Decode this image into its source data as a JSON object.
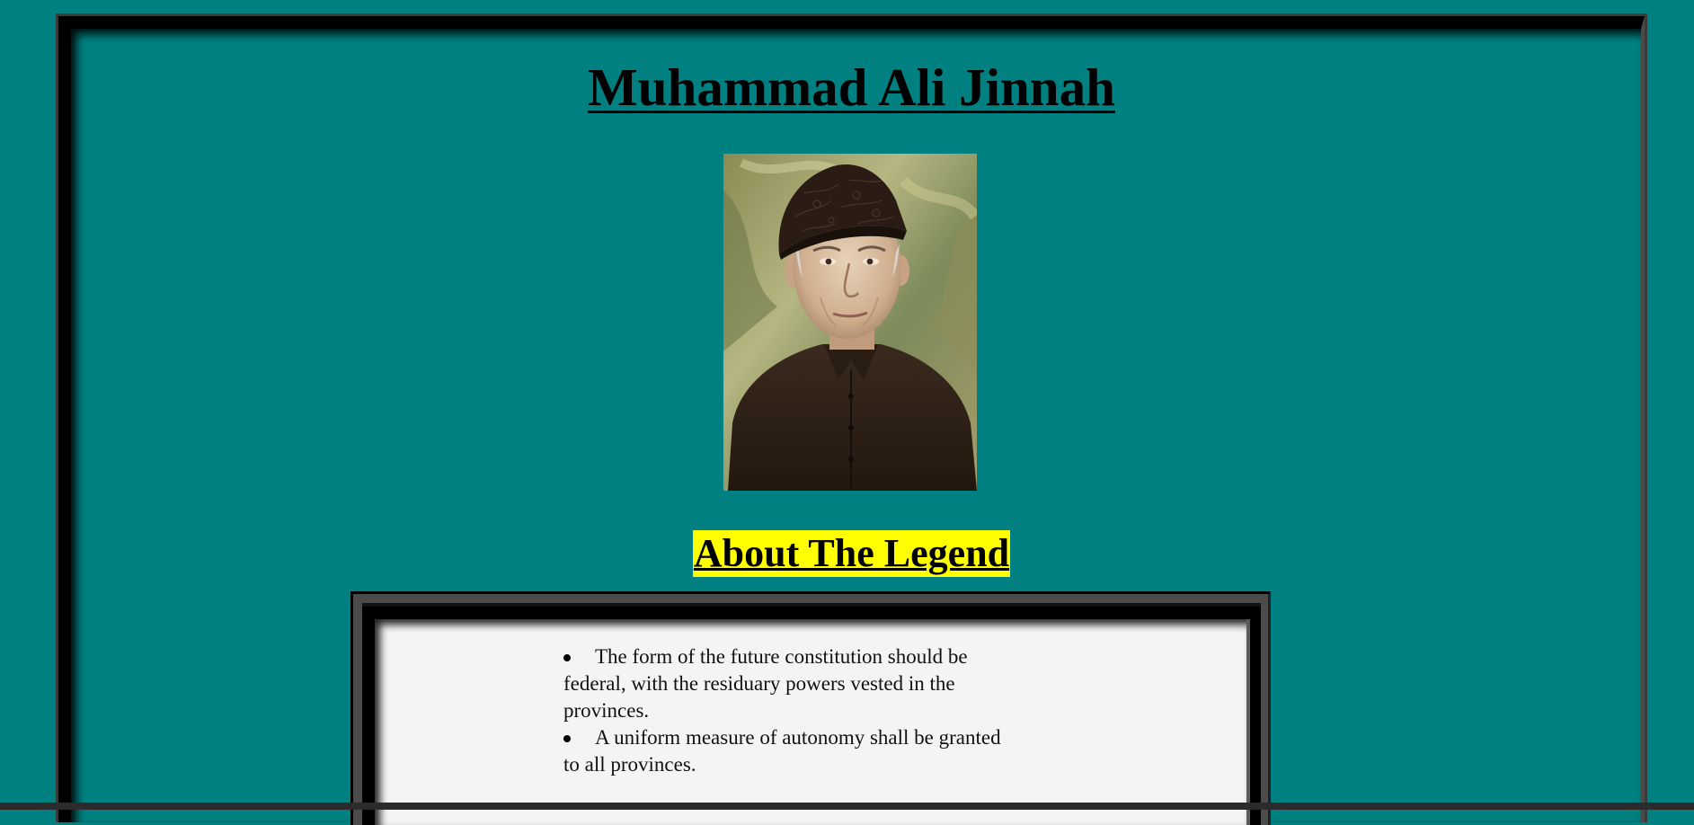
{
  "page": {
    "title": "Muhammad Ali Jinnah",
    "background_color": "#008080"
  },
  "portrait": {
    "icon": "portrait-photo"
  },
  "about": {
    "heading": "About The Legend",
    "highlight_color": "#ffff00",
    "points": [
      "The form of the future constitution should be federal, with the residuary powers vested in the provinces.",
      "A uniform measure of autonomy shall be granted to all provinces."
    ]
  }
}
